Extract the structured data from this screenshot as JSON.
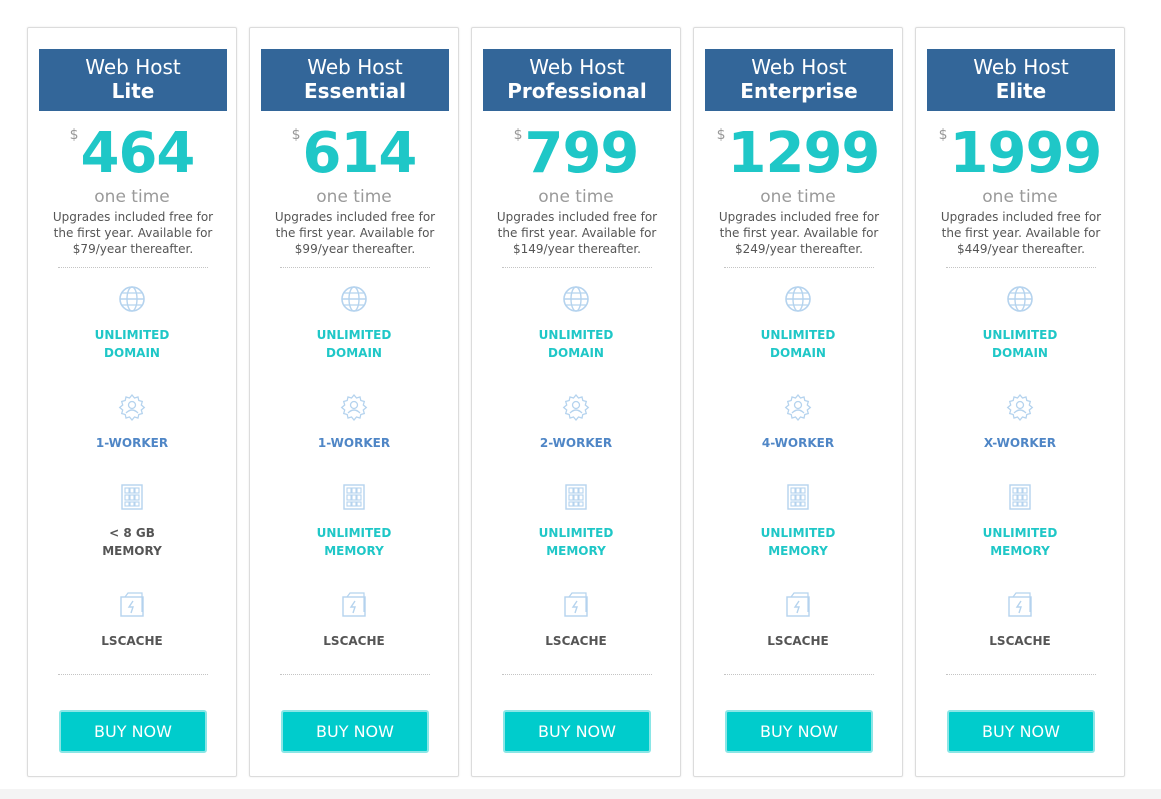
{
  "accent_color": "#1fc7c7",
  "header_color": "#336699",
  "button_color": "#00cccc",
  "plans": [
    {
      "name_line1": "Web Host",
      "name_line2": "Lite",
      "currency": "$",
      "price": "464",
      "period": "one time",
      "description": "Upgrades included free for the first year. Available for $79/year thereafter.",
      "features": [
        {
          "icon": "globe-icon",
          "label": "UNLIMITED\nDOMAIN",
          "tone": "teal"
        },
        {
          "icon": "worker-gear-icon",
          "label": "1-WORKER",
          "tone": "blue"
        },
        {
          "icon": "memory-chip-icon",
          "label": "< 8 GB\nMEMORY",
          "tone": "dark"
        },
        {
          "icon": "cache-icon",
          "label": "LSCACHE",
          "tone": "dark"
        }
      ],
      "button": "BUY NOW"
    },
    {
      "name_line1": "Web Host",
      "name_line2": "Essential",
      "currency": "$",
      "price": "614",
      "period": "one time",
      "description": "Upgrades included free for the first year. Available for $99/year thereafter.",
      "features": [
        {
          "icon": "globe-icon",
          "label": "UNLIMITED\nDOMAIN",
          "tone": "teal"
        },
        {
          "icon": "worker-gear-icon",
          "label": "1-WORKER",
          "tone": "blue"
        },
        {
          "icon": "memory-chip-icon",
          "label": "UNLIMITED\nMEMORY",
          "tone": "teal"
        },
        {
          "icon": "cache-icon",
          "label": "LSCACHE",
          "tone": "dark"
        }
      ],
      "button": "BUY NOW"
    },
    {
      "name_line1": "Web Host",
      "name_line2": "Professional",
      "currency": "$",
      "price": "799",
      "period": "one time",
      "description": "Upgrades included free for the first year. Available for $149/year thereafter.",
      "features": [
        {
          "icon": "globe-icon",
          "label": "UNLIMITED\nDOMAIN",
          "tone": "teal"
        },
        {
          "icon": "worker-gear-icon",
          "label": "2-WORKER",
          "tone": "blue"
        },
        {
          "icon": "memory-chip-icon",
          "label": "UNLIMITED\nMEMORY",
          "tone": "teal"
        },
        {
          "icon": "cache-icon",
          "label": "LSCACHE",
          "tone": "dark"
        }
      ],
      "button": "BUY NOW"
    },
    {
      "name_line1": "Web Host",
      "name_line2": "Enterprise",
      "currency": "$",
      "price": "1299",
      "period": "one time",
      "description": "Upgrades included free for the first year. Available for $249/year thereafter.",
      "features": [
        {
          "icon": "globe-icon",
          "label": "UNLIMITED\nDOMAIN",
          "tone": "teal"
        },
        {
          "icon": "worker-gear-icon",
          "label": "4-WORKER",
          "tone": "blue"
        },
        {
          "icon": "memory-chip-icon",
          "label": "UNLIMITED\nMEMORY",
          "tone": "teal"
        },
        {
          "icon": "cache-icon",
          "label": "LSCACHE",
          "tone": "dark"
        }
      ],
      "button": "BUY NOW"
    },
    {
      "name_line1": "Web Host",
      "name_line2": "Elite",
      "currency": "$",
      "price": "1999",
      "period": "one time",
      "description": "Upgrades included free for the first year. Available for $449/year thereafter.",
      "features": [
        {
          "icon": "globe-icon",
          "label": "UNLIMITED\nDOMAIN",
          "tone": "teal"
        },
        {
          "icon": "worker-gear-icon",
          "label": "X-WORKER",
          "tone": "blue"
        },
        {
          "icon": "memory-chip-icon",
          "label": "UNLIMITED\nMEMORY",
          "tone": "teal"
        },
        {
          "icon": "cache-icon",
          "label": "LSCACHE",
          "tone": "dark"
        }
      ],
      "button": "BUY NOW"
    }
  ]
}
